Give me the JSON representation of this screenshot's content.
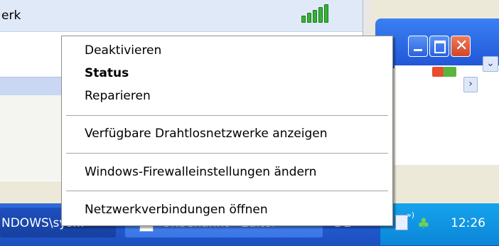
{
  "network_list": {
    "row_label": "erk",
    "signal_icon": "signal-strength-icon"
  },
  "context_menu": {
    "items": [
      {
        "label": "Deaktivieren",
        "bold": false
      },
      {
        "label": "Status",
        "bold": true
      },
      {
        "label": "Reparieren",
        "bold": false
      },
      {
        "label": "Verfügbare Drahtlosnetzwerke anzeigen",
        "bold": false
      },
      {
        "label": "Windows-Firewalleinstellungen ändern",
        "bold": false
      },
      {
        "label": "Netzwerkverbindungen öffnen",
        "bold": false
      }
    ]
  },
  "window": {
    "close_glyph": "✕",
    "scroll_down_glyph": "⌄",
    "scroll_right_glyph": "›"
  },
  "taskbar": {
    "task1_label": "NDOWS\\sys...",
    "task2_label": "Unbenannt - Editor",
    "language": "DE",
    "clock": "12:26",
    "tray_wave": "»)"
  },
  "colors": {
    "taskbar_blue": "#245edb",
    "tray_blue": "#0c86d8",
    "close_red": "#d1452a"
  }
}
